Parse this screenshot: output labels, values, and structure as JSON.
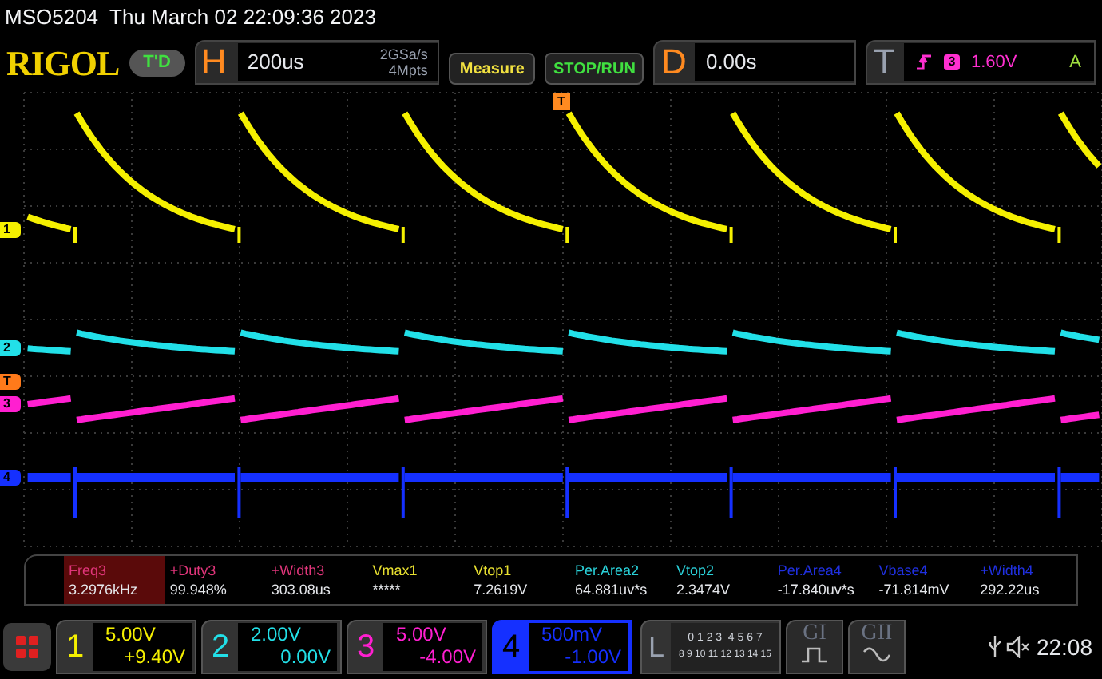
{
  "header": "MSO5204  Thu March 02 22:09:36 2023",
  "top_bar": {
    "logo": "RIGOL",
    "run_state": "T'D",
    "horizontal": {
      "letter": "H",
      "timebase": "200us",
      "sample_rate": "2GSa/s",
      "memory_depth": "4Mpts"
    },
    "measure_button": "Measure",
    "stop_run_button": "STOP/RUN",
    "delay": {
      "letter": "D",
      "value": "0.00s"
    },
    "trigger": {
      "letter": "T",
      "source": "3",
      "level": "1.60V",
      "mode": "A"
    }
  },
  "trigger_marker": "T",
  "traces": [
    {
      "marker": "1",
      "color": "#f5f000",
      "kind": "decay"
    },
    {
      "marker": "2",
      "color": "#22e0e8",
      "kind": "flat-decay"
    },
    {
      "marker": "T",
      "color": "#ff7a1a",
      "kind": "none"
    },
    {
      "marker": "3",
      "color": "#ff1fd0",
      "kind": "rise"
    },
    {
      "marker": "4",
      "color": "#1530ff",
      "kind": "pulse"
    }
  ],
  "measurements": [
    {
      "label": "Freq3",
      "value": "3.2976kHz",
      "color": "#e0357a",
      "selected": true
    },
    {
      "label": "+Duty3",
      "value": "99.948%",
      "color": "#e0357a",
      "selected": false
    },
    {
      "label": "+Width3",
      "value": "303.08us",
      "color": "#e0357a",
      "selected": false
    },
    {
      "label": "Vmax1",
      "value": "*****",
      "color": "#e8e030",
      "selected": false
    },
    {
      "label": "Vtop1",
      "value": "7.2619V",
      "color": "#e8e030",
      "selected": false
    },
    {
      "label": "Per.Area2",
      "value": "64.881uv*s",
      "color": "#2ad0d8",
      "selected": false
    },
    {
      "label": "Vtop2",
      "value": "2.3474V",
      "color": "#2ad0d8",
      "selected": false
    },
    {
      "label": "Per.Area4",
      "value": "-17.840uv*s",
      "color": "#2030e0",
      "selected": false
    },
    {
      "label": "Vbase4",
      "value": "-71.814mV",
      "color": "#2030e0",
      "selected": false
    },
    {
      "label": "+Width4",
      "value": "292.22us",
      "color": "#2030e0",
      "selected": false
    }
  ],
  "channels": [
    {
      "number": "1",
      "scale": "5.00V",
      "offset": "+9.40V",
      "color": "#f5f000",
      "selected": false
    },
    {
      "number": "2",
      "scale": "2.00V",
      "offset": "0.00V",
      "color": "#22e0e8",
      "selected": false
    },
    {
      "number": "3",
      "scale": "5.00V",
      "offset": "-4.00V",
      "color": "#ff1fd0",
      "selected": false
    },
    {
      "number": "4",
      "scale": "500mV",
      "offset": "-1.00V",
      "color": "#1530ff",
      "selected": true
    }
  ],
  "logic": {
    "letter": "L",
    "row_1": "0 1 2 3  4 5 6 7",
    "row_2": "8 9 10 11 12 13 14 15"
  },
  "generators": [
    "GI",
    "GII"
  ],
  "clock": "22:08"
}
